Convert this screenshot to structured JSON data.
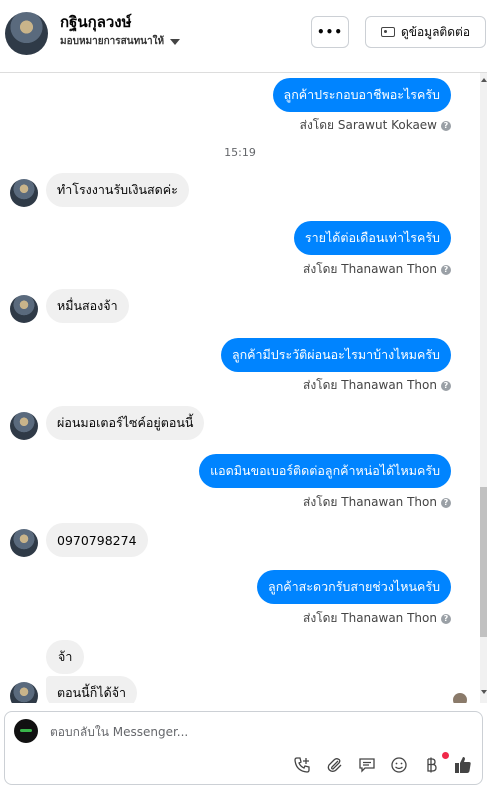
{
  "header": {
    "name": "กฐินกุลวงษ์",
    "subtitle": "มอบหมายการสนทนาให้",
    "more_label": "•••",
    "contact_label": "ดูข้อมูลติดต่อ"
  },
  "messages": [
    {
      "dir": "out",
      "text": "ลูกค้าประกอบอาชีพอะไรครับ",
      "sent_by": "ส่งโดย Sarawut Kokaew"
    },
    {
      "timestamp": "15:19"
    },
    {
      "dir": "in",
      "text": "ทำโรงงานรับเงินสดค่ะ"
    },
    {
      "dir": "out",
      "text": "รายได้ต่อเดือนเท่าไรครับ",
      "sent_by": "ส่งโดย Thanawan Thon"
    },
    {
      "dir": "in",
      "text": "หมื่นสองจ้า"
    },
    {
      "dir": "out",
      "text": "ลูกค้ามีประวัติผ่อนอะไรมาบ้างไหมครับ",
      "sent_by": "ส่งโดย Thanawan Thon"
    },
    {
      "dir": "in",
      "text": "ผ่อนมอเตอร์ไซค์อยู่ตอนนี้"
    },
    {
      "dir": "out",
      "text": "แอดมินขอเบอร์ติดต่อลูกค้าหน่อได้ไหมครับ",
      "sent_by": "ส่งโดย Thanawan Thon"
    },
    {
      "dir": "in",
      "text": "0970798274"
    },
    {
      "dir": "out",
      "text": "ลูกค้าสะดวกรับสายช่วงไหนครับ",
      "sent_by": "ส่งโดย Thanawan Thon"
    },
    {
      "dir": "in",
      "text": "จ้า"
    },
    {
      "dir": "in",
      "text": "ตอนนี้ก็ได้จ้า"
    }
  ],
  "composer": {
    "placeholder": "ตอบกลับใน Messenger...",
    "tools": [
      "phone-add-icon",
      "paperclip-icon",
      "saved-reply-icon",
      "emoji-icon",
      "baht-icon",
      "thumbs-up-icon"
    ]
  },
  "colors": {
    "outgoing_bubble": "#0084ff",
    "incoming_bubble": "#f0f0f0",
    "accent": "#0084ff"
  }
}
